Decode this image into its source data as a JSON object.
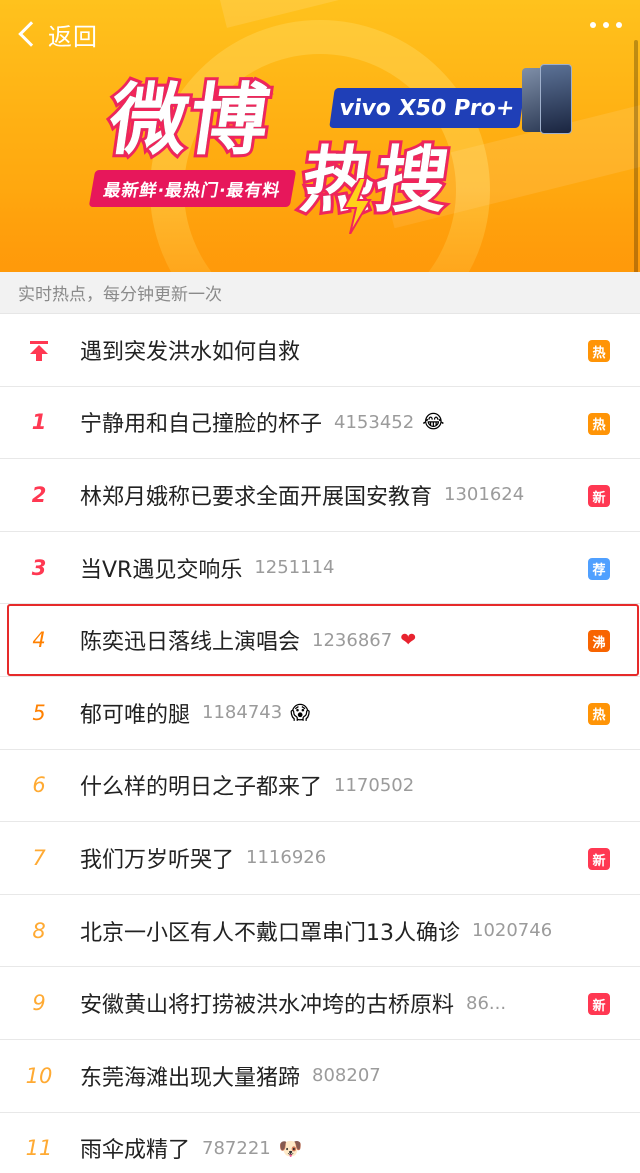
{
  "header": {
    "back_label": "返回",
    "title_line1": "微博",
    "title_line2": "热搜",
    "tagline": "最新鲜·最热门·最有料",
    "sponsor": "vivo X50 Pro+"
  },
  "section": {
    "label": "实时热点，每分钟更新一次"
  },
  "items": [
    {
      "rank": "",
      "pinned": true,
      "topic": "遇到突发洪水如何自救",
      "count": "",
      "emoji": "",
      "badge": "热",
      "badge_color": "#ff9406"
    },
    {
      "rank": "1",
      "pinned": false,
      "topic": "宁静用和自己撞脸的杯子",
      "count": "4153452",
      "emoji": "😂",
      "badge": "热",
      "badge_color": "#ff9406"
    },
    {
      "rank": "2",
      "pinned": false,
      "topic": "林郑月娥称已要求全面开展国安教育",
      "count": "1301624",
      "emoji": "",
      "badge": "新",
      "badge_color": "#ff3852"
    },
    {
      "rank": "3",
      "pinned": false,
      "topic": "当VR遇见交响乐",
      "count": "1251114",
      "emoji": "",
      "badge": "荐",
      "badge_color": "#50a0ff"
    },
    {
      "rank": "4",
      "pinned": false,
      "topic": "陈奕迅日落线上演唱会",
      "count": "1236867",
      "emoji": "❤",
      "badge": "沸",
      "badge_color": "#f86400"
    },
    {
      "rank": "5",
      "pinned": false,
      "topic": "郁可唯的腿",
      "count": "1184743",
      "emoji": "😱",
      "badge": "热",
      "badge_color": "#ff9406"
    },
    {
      "rank": "6",
      "pinned": false,
      "topic": "什么样的明日之子都来了",
      "count": "1170502",
      "emoji": "",
      "badge": "",
      "badge_color": ""
    },
    {
      "rank": "7",
      "pinned": false,
      "topic": "我们万岁听哭了",
      "count": "1116926",
      "emoji": "",
      "badge": "新",
      "badge_color": "#ff3852"
    },
    {
      "rank": "8",
      "pinned": false,
      "topic": "北京一小区有人不戴口罩串门13人确诊",
      "count": "1020746",
      "emoji": "",
      "badge": "",
      "badge_color": ""
    },
    {
      "rank": "9",
      "pinned": false,
      "topic": "安徽黄山将打捞被洪水冲垮的古桥原料",
      "count": "86...",
      "emoji": "",
      "badge": "新",
      "badge_color": "#ff3852"
    },
    {
      "rank": "10",
      "pinned": false,
      "topic": "东莞海滩出现大量猪蹄",
      "count": "808207",
      "emoji": "",
      "badge": "",
      "badge_color": ""
    },
    {
      "rank": "11",
      "pinned": false,
      "topic": "雨伞成精了",
      "count": "787221",
      "emoji": "🐶",
      "badge": "",
      "badge_color": ""
    }
  ],
  "highlighted_rank": "4"
}
